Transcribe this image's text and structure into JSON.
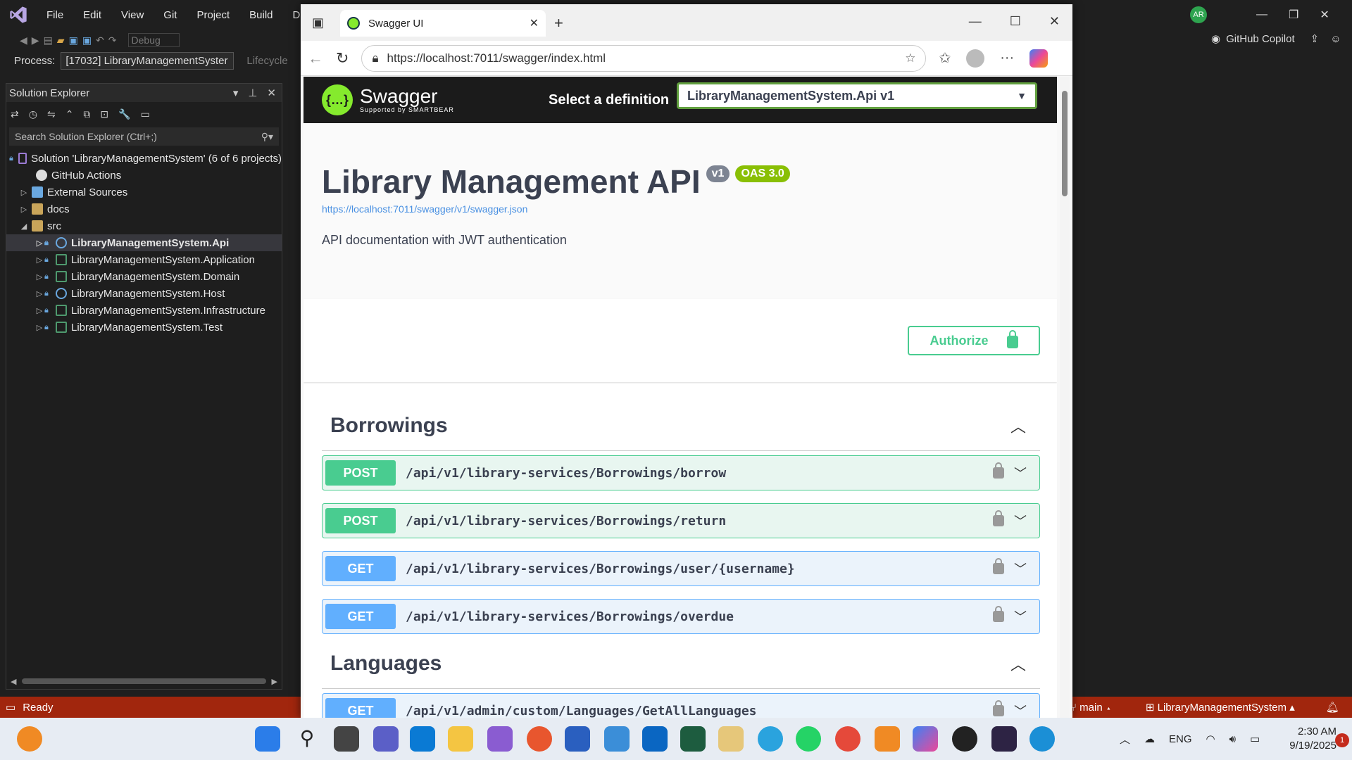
{
  "vs": {
    "menu": [
      "File",
      "Edit",
      "View",
      "Git",
      "Project",
      "Build",
      "Debug"
    ],
    "config": "Debug",
    "process_label": "Process:",
    "process_value": "[17032] LibraryManagementSyster",
    "lifecycle": "Lifecycle",
    "avatar": "AR",
    "copilot": "GitHub Copilot"
  },
  "solution_explorer": {
    "title": "Solution Explorer",
    "search_placeholder": "Search Solution Explorer (Ctrl+;)",
    "solution": "Solution 'LibraryManagementSystem' (6 of 6 projects)",
    "items": [
      {
        "label": "GitHub Actions"
      },
      {
        "label": "External Sources"
      },
      {
        "label": "docs"
      },
      {
        "label": "src"
      }
    ],
    "projects": [
      {
        "label": "LibraryManagementSystem.Api"
      },
      {
        "label": "LibraryManagementSystem.Application"
      },
      {
        "label": "LibraryManagementSystem.Domain"
      },
      {
        "label": "LibraryManagementSystem.Host"
      },
      {
        "label": "LibraryManagementSystem.Infrastructure"
      },
      {
        "label": "LibraryManagementSystem.Test"
      }
    ]
  },
  "status": {
    "ready": "Ready",
    "branch": "main",
    "repo": "LibraryManagementSystem"
  },
  "browser": {
    "tab_title": "Swagger UI",
    "url": "https://localhost:7011/swagger/index.html"
  },
  "swagger": {
    "brand": "Swagger",
    "brand_sub": "Supported by SMARTBEAR",
    "select_label": "Select a definition",
    "definition": "LibraryManagementSystem.Api v1",
    "title": "Library Management API",
    "version": "v1",
    "oas": "OAS 3.0",
    "spec_url": "https://localhost:7011/swagger/v1/swagger.json",
    "description": "API documentation with JWT authentication",
    "authorize": "Authorize",
    "tags": [
      {
        "name": "Borrowings",
        "ops": [
          {
            "method": "POST",
            "path": "/api/v1/library-services/Borrowings/borrow"
          },
          {
            "method": "POST",
            "path": "/api/v1/library-services/Borrowings/return"
          },
          {
            "method": "GET",
            "path": "/api/v1/library-services/Borrowings/user/{username}"
          },
          {
            "method": "GET",
            "path": "/api/v1/library-services/Borrowings/overdue"
          }
        ]
      },
      {
        "name": "Languages",
        "ops": [
          {
            "method": "GET",
            "path": "/api/v1/admin/custom/Languages/GetAllLanguages"
          }
        ]
      }
    ]
  },
  "taskbar": {
    "lang": "ENG",
    "time": "2:30 AM",
    "date": "9/19/2025",
    "notif": "1"
  }
}
